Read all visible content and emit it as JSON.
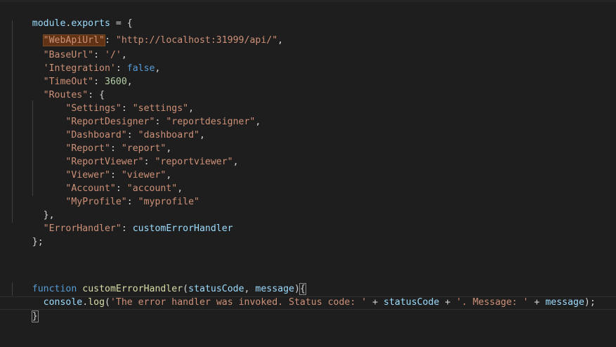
{
  "editor": {
    "lines": {
      "l1": {
        "module": "module",
        "dot": ".",
        "exports": "exports",
        "rest": " = {"
      },
      "l2": {
        "indent": "  ",
        "key": "\"WebApiUrl\"",
        "colon": ": ",
        "value": "\"http://localhost:31999/api/\"",
        "end": ","
      },
      "l3": {
        "indent": "  ",
        "key": "\"BaseUrl\"",
        "colon": ": ",
        "value": "'/'",
        "end": ","
      },
      "l4": {
        "indent": "  ",
        "key": "'Integration'",
        "colon": ": ",
        "value": "false",
        "end": ","
      },
      "l5": {
        "indent": "  ",
        "key": "\"TimeOut\"",
        "colon": ": ",
        "value": "3600",
        "end": ","
      },
      "l6": {
        "indent": "  ",
        "key": "\"Routes\"",
        "colon": ": ",
        "value": "{"
      },
      "r1": {
        "indent": "      ",
        "key": "\"Settings\"",
        "colon": ": ",
        "value": "\"settings\"",
        "end": ","
      },
      "r2": {
        "indent": "      ",
        "key": "\"ReportDesigner\"",
        "colon": ": ",
        "value": "\"reportdesigner\"",
        "end": ","
      },
      "r3": {
        "indent": "      ",
        "key": "\"Dashboard\"",
        "colon": ": ",
        "value": "\"dashboard\"",
        "end": ","
      },
      "r4": {
        "indent": "      ",
        "key": "\"Report\"",
        "colon": ": ",
        "value": "\"report\"",
        "end": ","
      },
      "r5": {
        "indent": "      ",
        "key": "\"ReportViewer\"",
        "colon": ": ",
        "value": "\"reportviewer\"",
        "end": ","
      },
      "r6": {
        "indent": "      ",
        "key": "\"Viewer\"",
        "colon": ": ",
        "value": "\"viewer\"",
        "end": ","
      },
      "r7": {
        "indent": "      ",
        "key": "\"Account\"",
        "colon": ": ",
        "value": "\"account\"",
        "end": ","
      },
      "r8": {
        "indent": "      ",
        "key": "\"MyProfile\"",
        "colon": ": ",
        "value": "\"myprofile\""
      },
      "l15": {
        "text": "  },"
      },
      "l16": {
        "indent": "  ",
        "key": "\"ErrorHandler\"",
        "colon": ": ",
        "value": "customErrorHandler"
      },
      "l17": {
        "text": "};"
      },
      "f1": {
        "kw": "function",
        "sp": " ",
        "name": "customErrorHandler",
        "open": "(",
        "p1": "statusCode",
        "comma": ", ",
        "p2": "message",
        "close": ")",
        "brace": "{"
      },
      "f2": {
        "indent": "  ",
        "obj": "console",
        "dot": ".",
        "method": "log",
        "open": "(",
        "s1": "'The error handler was invoked. Status code: '",
        "plus1": " + ",
        "v1": "statusCode",
        "plus2": " + ",
        "s2": "'. Message: '",
        "plus3": " + ",
        "v2": "message",
        "end": ");"
      },
      "f3": {
        "brace": "}"
      }
    }
  }
}
